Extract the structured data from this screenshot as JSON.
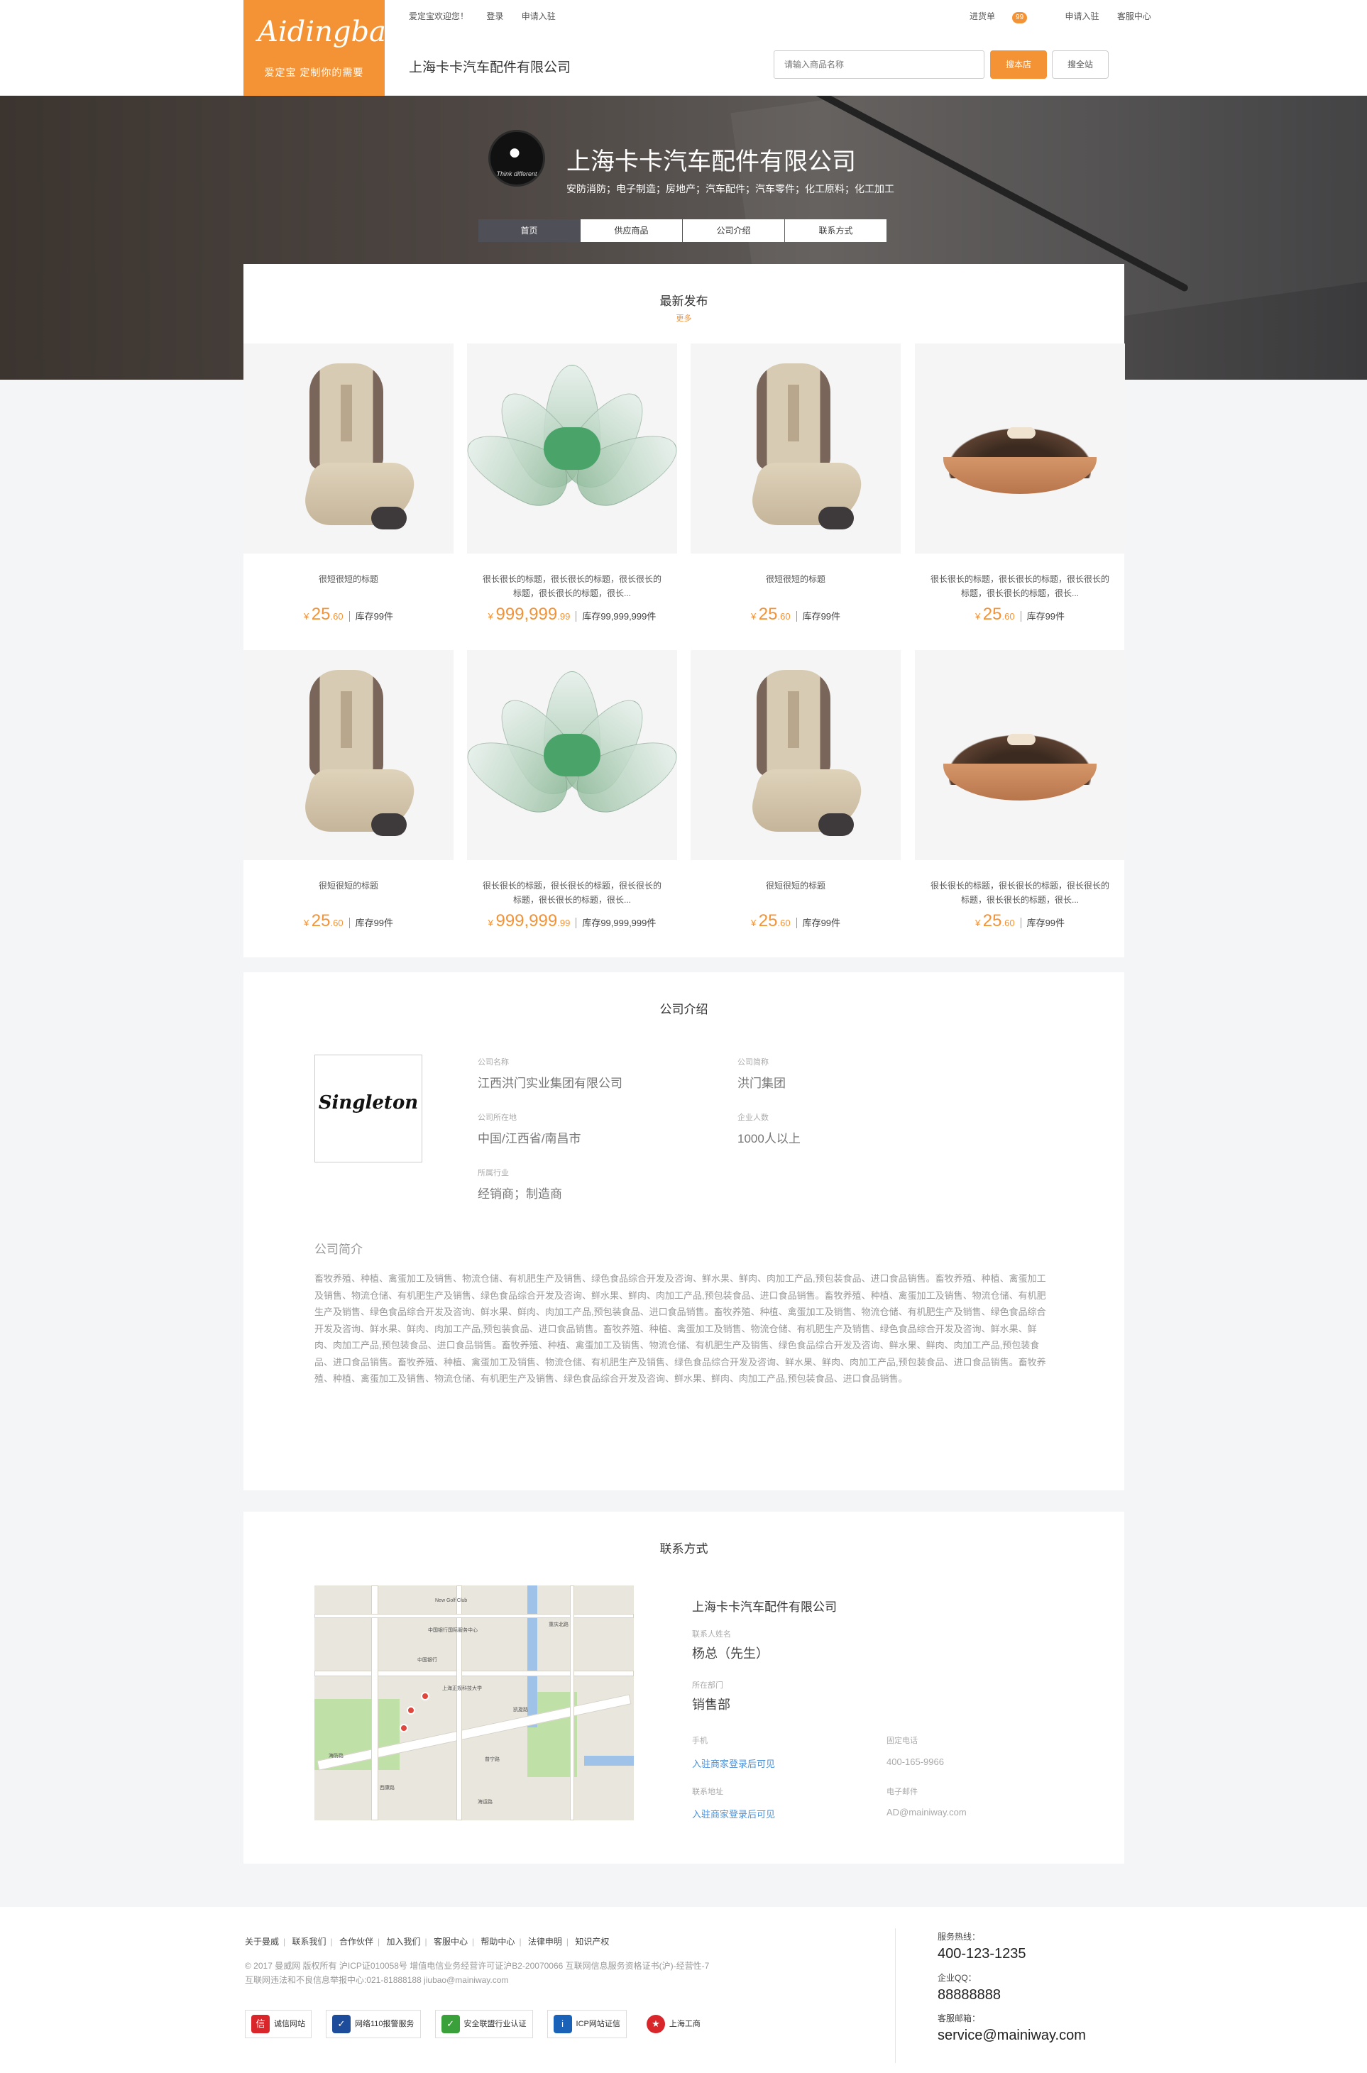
{
  "header": {
    "logo_brand": "Aidingbao",
    "logo_slogan": "爱定宝  定制你的需要",
    "welcome": "爱定宝欢迎您！",
    "login": "登录",
    "apply": "申请入驻",
    "cart_label": "进货单",
    "cart_count": "99",
    "apply_right": "申请入驻",
    "service_center": "客服中心",
    "shop_name": "上海卡卡汽车配件有限公司",
    "search_placeholder": "请输入商品名称",
    "search_shop_btn": "搜本店",
    "search_all_btn": "搜全站"
  },
  "banner": {
    "avatar_text": "Think different",
    "title": "上海卡卡汽车配件有限公司",
    "categories": "安防消防；电子制造；房地产；汽车配件；汽车零件；化工原料；化工加工",
    "tabs": [
      "首页",
      "供应商品",
      "公司介绍",
      "联系方式"
    ],
    "active_tab": 0
  },
  "latest": {
    "title": "最新发布",
    "more": "更多",
    "products": [
      {
        "image": "seat",
        "title": "很短很短的标题",
        "currency": "¥",
        "price_int": "25",
        "price_dec": ".60",
        "stock": "库存99件"
      },
      {
        "image": "lotus",
        "title": "很长很长的标题，很长很长的标题，很长很长的标题，很长很长的标题，很长...",
        "currency": "¥",
        "price_int": "999,999",
        "price_dec": ".99",
        "stock": "库存99,999,999件"
      },
      {
        "image": "seat",
        "title": "很短很短的标题",
        "currency": "¥",
        "price_int": "25",
        "price_dec": ".60",
        "stock": "库存99件"
      },
      {
        "image": "seeds",
        "title": "很长很长的标题，很长很长的标题，很长很长的标题，很长很长的标题，很长...",
        "currency": "¥",
        "price_int": "25",
        "price_dec": ".60",
        "stock": "库存99件"
      },
      {
        "image": "seat",
        "title": "很短很短的标题",
        "currency": "¥",
        "price_int": "25",
        "price_dec": ".60",
        "stock": "库存99件"
      },
      {
        "image": "lotus",
        "title": "很长很长的标题，很长很长的标题，很长很长的标题，很长很长的标题，很长...",
        "currency": "¥",
        "price_int": "999,999",
        "price_dec": ".99",
        "stock": "库存99,999,999件"
      },
      {
        "image": "seat",
        "title": "很短很短的标题",
        "currency": "¥",
        "price_int": "25",
        "price_dec": ".60",
        "stock": "库存99件"
      },
      {
        "image": "seeds",
        "title": "很长很长的标题，很长很长的标题，很长很长的标题，很长很长的标题，很长...",
        "currency": "¥",
        "price_int": "25",
        "price_dec": ".60",
        "stock": "库存99件"
      }
    ]
  },
  "company": {
    "title": "公司介绍",
    "logo_text": "Singleton",
    "name_label": "公司名称",
    "name_value": "江西洪门实业集团有限公司",
    "short_label": "公司简称",
    "short_value": "洪门集团",
    "location_label": "公司所在地",
    "location_value": "中国/江西省/南昌市",
    "staff_label": "企业人数",
    "staff_value": "1000人以上",
    "industry_label": "所属行业",
    "industry_value": "经销商；制造商",
    "intro_heading": "公司简介",
    "intro_text": "畜牧养殖、种植、禽蛋加工及销售、物流仓储、有机肥生产及销售、绿色食品综合开发及咨询、鲜水果、鲜肉、肉加工产品,预包装食品、进口食品销售。畜牧养殖、种植、禽蛋加工及销售、物流仓储、有机肥生产及销售、绿色食品综合开发及咨询、鲜水果、鲜肉、肉加工产品,预包装食品、进口食品销售。畜牧养殖、种植、禽蛋加工及销售、物流仓储、有机肥生产及销售、绿色食品综合开发及咨询、鲜水果、鲜肉、肉加工产品,预包装食品、进口食品销售。畜牧养殖、种植、禽蛋加工及销售、物流仓储、有机肥生产及销售、绿色食品综合开发及咨询、鲜水果、鲜肉、肉加工产品,预包装食品、进口食品销售。畜牧养殖、种植、禽蛋加工及销售、物流仓储、有机肥生产及销售、绿色食品综合开发及咨询、鲜水果、鲜肉、肉加工产品,预包装食品、进口食品销售。畜牧养殖、种植、禽蛋加工及销售、物流仓储、有机肥生产及销售、绿色食品综合开发及咨询、鲜水果、鲜肉、肉加工产品,预包装食品、进口食品销售。畜牧养殖、种植、禽蛋加工及销售、物流仓储、有机肥生产及销售、绿色食品综合开发及咨询、鲜水果、鲜肉、肉加工产品,预包装食品、进口食品销售。畜牧养殖、种植、禽蛋加工及销售、物流仓储、有机肥生产及销售、绿色食品综合开发及咨询、鲜水果、鲜肉、肉加工产品,预包装食品、进口食品销售。"
  },
  "contact": {
    "title": "联系方式",
    "company_name": "上海卡卡汽车配件有限公司",
    "person_label": "联系人姓名",
    "person_value": "杨总（先生）",
    "dept_label": "所在部门",
    "dept_value": "销售部",
    "mobile_label": "手机",
    "mobile_value": "入驻商家登录后可见",
    "phone_label": "固定电话",
    "phone_value": "400-165-9966",
    "address_label": "联系地址",
    "address_value": "入驻商家登录后可见",
    "email_label": "电子邮件",
    "email_value": "AD@mainiway.com",
    "map_labels": [
      "New Golf Club",
      "中国银行国际服务中心",
      "上海正规科技大学",
      "普宁路",
      "海防路",
      "凯旋路",
      "中国银行",
      "海运路",
      "西康路",
      "重庆北路"
    ]
  },
  "footer": {
    "links": [
      "关于曼威",
      "联系我们",
      "合作伙伴",
      "加入我们",
      "客服中心",
      "帮助中心",
      "法律申明",
      "知识产权"
    ],
    "copyright": "© 2017 曼威网 版权所有 沪ICP证010058号  增值电信业务经营许可证沪B2-20070066  互联网信息服务资格证书(沪)-经营性-7",
    "report": "互联网违法和不良信息举报中心:021-81888188 jiubao@mainiway.com",
    "badges": [
      "诚信网站",
      "网络110报警服务",
      "安全联盟行业认证",
      "ICP网站证信",
      "上海工商"
    ],
    "hotline_label": "服务热线：",
    "hotline_value": "400-123-1235",
    "qq_label": "企业QQ：",
    "qq_value": "88888888",
    "email_label": "客服邮箱：",
    "email_value": "service@mainiway.com"
  }
}
